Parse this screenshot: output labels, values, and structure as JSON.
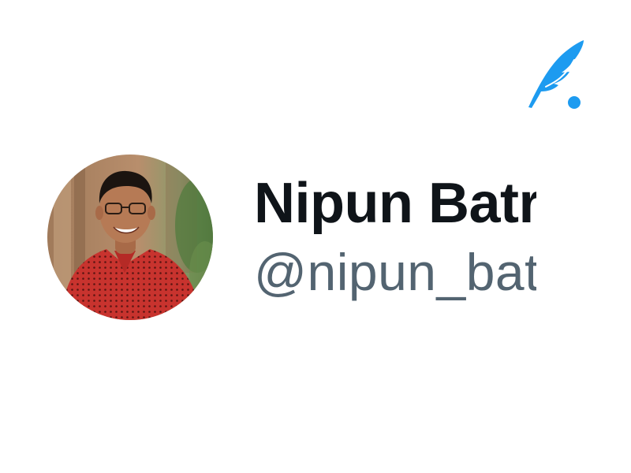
{
  "profile": {
    "display_name": "Nipun Batra",
    "handle": "@nipun_bat",
    "avatar_icon": "profile-photo"
  },
  "brand": {
    "logo_icon": "quill-feather-logo",
    "accent_color": "#1d9bf0"
  },
  "colors": {
    "name_color": "#0f1419",
    "handle_color": "#536471"
  }
}
